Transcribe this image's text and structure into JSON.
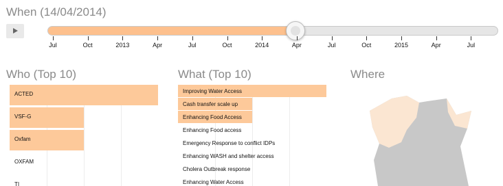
{
  "when": {
    "title": "When (14/04/2014)",
    "play_icon": "play-icon",
    "progress": 0.55,
    "ticks": [
      "Jul",
      "Oct",
      "2013",
      "Apr",
      "Jul",
      "Oct",
      "2014",
      "Apr",
      "Jul",
      "Oct",
      "2015",
      "Apr",
      "Jul"
    ]
  },
  "who": {
    "title": "Who (Top 10)",
    "items": [
      {
        "label": "ACTED",
        "value": 1.0
      },
      {
        "label": "VSF-G",
        "value": 0.5
      },
      {
        "label": "Oxfam",
        "value": 0.5
      },
      {
        "label": "OXFAM",
        "value": 0
      },
      {
        "label": "TI",
        "value": 0
      }
    ]
  },
  "what": {
    "title": "What (Top 10)",
    "items": [
      {
        "label": "Improving Water Access",
        "value": 1.0
      },
      {
        "label": "Cash transfer scale up",
        "value": 0.5
      },
      {
        "label": "Enhancing Food Access",
        "value": 0.5
      },
      {
        "label": "Enhancing Food access",
        "value": 0
      },
      {
        "label": "Emergency Response to conflict IDPs",
        "value": 0
      },
      {
        "label": "Enhancing WASH and shelter access",
        "value": 0
      },
      {
        "label": "Cholera Outbreak response",
        "value": 0
      },
      {
        "label": "Enhancing Water Access",
        "value": 0
      }
    ]
  },
  "where": {
    "title": "Where"
  },
  "colors": {
    "accent": "#fdc08d",
    "bar": "#fdc99a",
    "map_highlight": "#fbe6d2",
    "map_base": "#c8c8c8"
  }
}
